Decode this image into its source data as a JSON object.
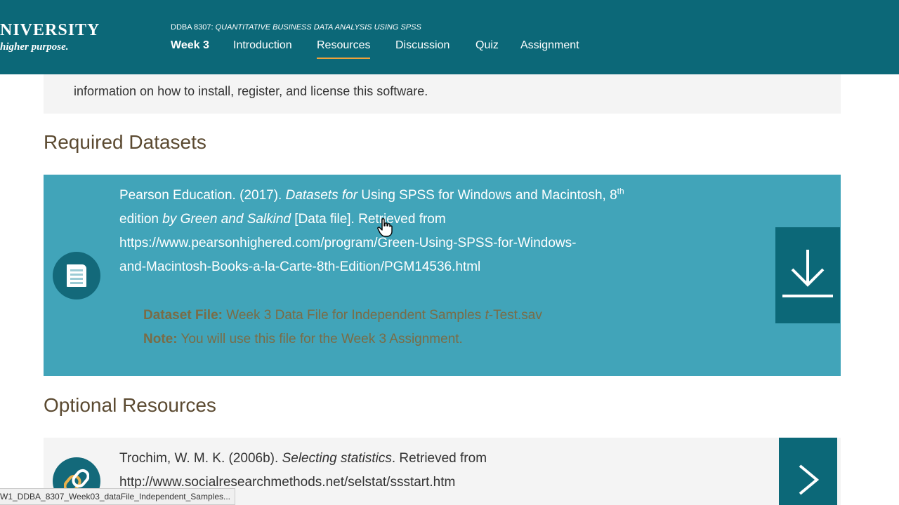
{
  "header": {
    "logo_top": "NIVERSITY",
    "logo_bottom": "higher purpose.",
    "course_code": "DDBA 8307:",
    "course_title": "QUANTITATIVE BUSINESS DATA ANALYSIS USING SPSS",
    "nav": {
      "week": "Week 3",
      "introduction": "Introduction",
      "resources": "Resources",
      "discussion": "Discussion",
      "quiz": "Quiz",
      "assignment": "Assignment",
      "active": "Resources"
    }
  },
  "intro_panel": {
    "text": "information on how to install, register, and license this software."
  },
  "required_datasets": {
    "title": "Required Datasets",
    "citation": {
      "part1": "Pearson Education. (2017). ",
      "part2_italic": "Datasets for",
      "part3": " Using SPSS for Windows and Macintosh, 8",
      "sup": "th",
      "part4": " edition ",
      "part5_italic": "by Green and Salkind",
      "part6": " [Data file]. Retrieved from",
      "url_line1": "https://www.pearsonhighered.com/program/Green-Using-SPSS-for-Windows-",
      "url_line2": "and-Macintosh-Books-a-la-Carte-8th-Edition/PGM14536.html"
    },
    "dataset_file_label": "Dataset File:",
    "dataset_file_value_pre": " Week 3 Data File for Independent Samples ",
    "dataset_file_value_italic": "t",
    "dataset_file_value_post": "-Test.sav",
    "note_label": "Note:",
    "note_value": " You will use this file for the Week 3 Assignment."
  },
  "optional_resources": {
    "title": "Optional Resources",
    "item": {
      "part1": "Trochim, W. M. K. (2006b). ",
      "part2_italic": "Selecting statistics",
      "part3": ". Retrieved from",
      "url": "http://www.socialresearchmethods.net/selstat/ssstart.htm"
    }
  },
  "status_bar": {
    "text": "W1_DDBA_8307_Week03_dataFile_Independent_Samples..."
  },
  "colors": {
    "header_bg": "#0c6878",
    "card_bg": "#41a4b9",
    "accent_underline": "#f0a23a",
    "section_title": "#5b4a31"
  }
}
